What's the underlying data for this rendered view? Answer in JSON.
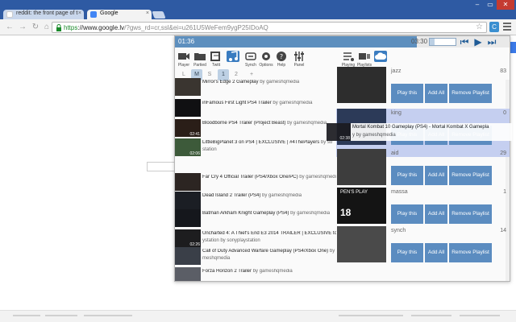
{
  "browser": {
    "tabs": [
      {
        "label": "reddit: the front page of t",
        "active": false
      },
      {
        "label": "Google",
        "active": true
      }
    ],
    "url_proto": "https",
    "url_rest": "://www.google.lv",
    "url_sub": "/?gws_rd=cr,ssl&ei=u261U5WeFem9ygP25IDoAQ",
    "ext_label": "C"
  },
  "page": {
    "signin_label": "et"
  },
  "player": {
    "elapsed": "01:36",
    "total": "03:30",
    "progress_fraction": 0.72,
    "volume_fraction": 0.2,
    "accent": "#5d8fbe",
    "controls": [
      "⏮",
      "▶",
      "⏭"
    ]
  },
  "nav": {
    "left_buttons": [
      {
        "label": "Player",
        "icon": "camera-icon"
      },
      {
        "label": "Partied",
        "icon": "folder-icon"
      },
      {
        "label": "Twitt",
        "icon": "tag-icon"
      },
      {
        "label": "",
        "icon": "music-icon"
      },
      {
        "label": "Synch",
        "icon": "sync-icon"
      },
      {
        "label": "Options",
        "icon": "gear-icon"
      },
      {
        "label": "Help",
        "icon": "help-icon"
      },
      {
        "label": "Panel",
        "icon": "sliders-icon"
      }
    ],
    "right_buttons": [
      {
        "label": "Playing",
        "icon": "playing-icon"
      },
      {
        "label": "Playlists",
        "icon": "playlists-icon"
      },
      {
        "label": "",
        "icon": "cloud-icon"
      }
    ],
    "size_tabs": [
      "L",
      "M",
      "S"
    ],
    "size_selected": "M",
    "pages": [
      "1",
      "2"
    ],
    "page_selected": "1",
    "add_label": "+"
  },
  "videos": [
    {
      "title": "Mirror's Edge 2 Gameplay",
      "by": "by gameshqmedia",
      "dur": "",
      "thumb": "#3a3530"
    },
    {
      "title": "inFamous First Light PS4 Trailer",
      "by": "by gameshqmedia",
      "dur": "",
      "thumb": "#101012"
    },
    {
      "title": "Bloodborne PS4 Trailer (Project Beast)",
      "by": "by gameshqmedia",
      "dur": "02:41",
      "thumb": "#2a1e18"
    },
    {
      "title": "LittleBigPlanet 3 on PS4 | EXCLUSIVE | #4ThePlayers",
      "by": "by so",
      "line2": "station",
      "dur": "02:06",
      "thumb": "#3d5a3a"
    },
    {
      "title": "",
      "by": "",
      "dur": "",
      "thumb": "#ffffff"
    },
    {
      "title": "Far Cry 4 Official Trailer (PS4/Xbox One/PC)",
      "by": "by gameshqmedia",
      "dur": "",
      "thumb": "#2c2522"
    },
    {
      "title": "Dead Island 2 Trailer (PS4)",
      "by": "by gameshqmedia",
      "dur": "",
      "thumb": "#1b1e24"
    },
    {
      "title": "Batman Arkham Knight Gameplay (PS4)",
      "by": "by gameshqmedia",
      "dur": "",
      "thumb": "#15171c"
    },
    {
      "title": "Uncharted 4: A Thief's End E3 2014 TRAILER | EXCLUSIVE to Pla",
      "by": "",
      "line2": "ystation by sonyplaystation",
      "dur": "02:26",
      "thumb": "#1d1d1f"
    },
    {
      "title": "Call of Duty Advanced Warfare Gameplay (PS4/Xbox One)",
      "by": "by ga",
      "line2": "meshqmedia",
      "dur": "",
      "thumb": "#3a3f48"
    },
    {
      "title": "Forza Horizon 2 Trailer",
      "by": "by gameshqmedia",
      "dur": "",
      "thumb": "#5b5e66"
    }
  ],
  "dragged": {
    "title": "Mortal Kombat 10 Gameplay (PS4) - Mortal Kombat X Gamepla",
    "line2": "y by gameshqmedia",
    "dur": "02:38"
  },
  "playlists": [
    {
      "name": "jazz",
      "count": "83",
      "thumb": "#2d2d2d",
      "highlighted": false
    },
    {
      "name": "king",
      "count": "0",
      "thumb": "#2c3a58",
      "highlighted": true
    },
    {
      "name": "aid",
      "count": "29",
      "thumb": "#3d3d3d",
      "highlighted": false
    },
    {
      "name": "massa",
      "count": "1",
      "thumb": "#141414",
      "highlighted": false
    },
    {
      "name": "synch",
      "count": "14",
      "thumb": "#4a4a4a",
      "highlighted": false
    }
  ],
  "playlist_buttons": {
    "play": "Play this",
    "add": "Add All",
    "remove": "Remove Playlist"
  },
  "thumb_text": {
    "massa_line1": "PEN'S PLAY",
    "massa_line2": "18"
  }
}
